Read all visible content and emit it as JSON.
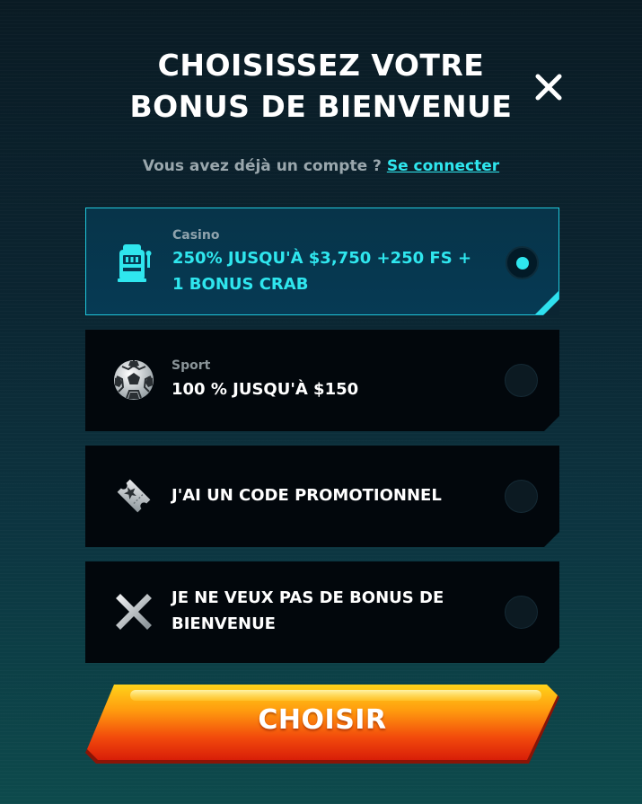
{
  "header": {
    "title_line1": "CHOISISSEZ VOTRE",
    "title_line2": "BONUS DE BIENVENUE",
    "close_icon": "close-icon"
  },
  "login": {
    "prompt": "Vous avez déjà un compte ?",
    "link": "Se connecter"
  },
  "options": [
    {
      "category": "Casino",
      "label": "250% JUSQU'À $3,750 +250 FS + 1 BONUS CRAB",
      "icon": "slot-machine-icon",
      "selected": true
    },
    {
      "category": "Sport",
      "label": "100 % JUSQU'À $150",
      "icon": "soccer-ball-icon",
      "selected": false
    },
    {
      "category": "",
      "label": "J'AI UN CODE PROMOTIONNEL",
      "icon": "ticket-icon",
      "selected": false
    },
    {
      "category": "",
      "label": "JE NE VEUX PAS DE BONUS DE BIENVENUE",
      "icon": "x-icon",
      "selected": false
    }
  ],
  "cta": {
    "label": "CHOISIR"
  },
  "colors": {
    "accent": "#2fe6ee",
    "cta_top": "#ffd21a",
    "cta_bottom": "#e0200a"
  }
}
